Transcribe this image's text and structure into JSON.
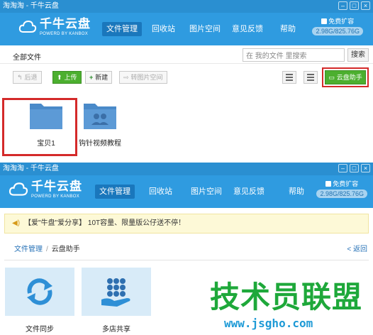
{
  "window1": {
    "title": "淘淘淘 - 千牛云盘",
    "logo": {
      "cn": "千牛云盘",
      "en": "POWERD BY KANBOX"
    },
    "nav": [
      "文件管理",
      "回收站",
      "图片空间",
      "意见反馈",
      "帮助"
    ],
    "quota": {
      "expand": "免费扩容",
      "size": "2.98G/825.76G"
    },
    "breadcrumb": "全部文件",
    "search": {
      "placeholder": "在 我的文件 里搜索",
      "button": "搜索"
    },
    "toolbar": {
      "back": "后退",
      "upload": "上传",
      "new": "新建",
      "to_image_space": "转图片空间",
      "helper": "云盘助手"
    },
    "files": [
      {
        "name": "宝贝1"
      },
      {
        "name": "钩针视频教程"
      }
    ]
  },
  "window2": {
    "title": "淘淘淘 - 千牛云盘",
    "logo": {
      "cn": "千牛云盘",
      "en": "POWERD BY KANBOX"
    },
    "nav": [
      "文件管理",
      "回收站",
      "图片空间",
      "意见反馈",
      "帮助"
    ],
    "quota": {
      "expand": "免费扩容",
      "size": "2.98G/825.76G"
    },
    "banner": "【爱\"牛盘\"爱分享】 10T容量、限量版公仔送不停！",
    "crumbs": {
      "root": "文件管理",
      "sep": "/",
      "current": "云盘助手",
      "back": "< 返回"
    },
    "apps": [
      {
        "name": "文件同步"
      },
      {
        "name": "多店共享"
      }
    ]
  },
  "watermark": {
    "text": "技术员联盟",
    "url": "www.jsgho.com"
  },
  "colors": {
    "header": "#2f9be0",
    "accent_green": "#4caf2f",
    "highlight_red": "#d42a2a"
  }
}
